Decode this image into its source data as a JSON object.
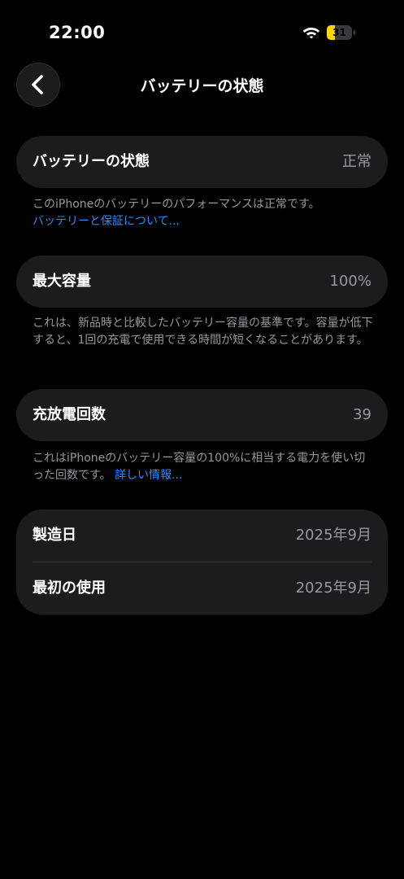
{
  "status_bar": {
    "time": "22:00",
    "battery_level": "31",
    "battery_fraction": 0.31,
    "battery_color": "#ffd60a",
    "icons": [
      "wifi-icon",
      "battery-icon"
    ]
  },
  "nav": {
    "back_icon": "chevron-left-icon",
    "title": "バッテリーの状態"
  },
  "sections": {
    "health": {
      "label": "バッテリーの状態",
      "value": "正常",
      "footnote": "このiPhoneのバッテリーのパフォーマンスは正常です。",
      "link": "バッテリーと保証について..."
    },
    "capacity": {
      "label": "最大容量",
      "value": "100%",
      "footnote": "これは、新品時と比較したバッテリー容量の基準です。容量が低下すると、1回の充電で使用できる時間が短くなることがあります。"
    },
    "cycles": {
      "label": "充放電回数",
      "value": "39",
      "footnote": "これはiPhoneのバッテリー容量の100%に相当する電力を使い切った回数です。",
      "link": "詳しい情報..."
    },
    "dates": {
      "manufacture_label": "製造日",
      "manufacture_value": "2025年9月",
      "first_use_label": "最初の使用",
      "first_use_value": "2025年9月"
    }
  },
  "colors": {
    "background": "#000000",
    "card": "#1c1c1e",
    "secondary_text": "#98989f",
    "link": "#2f8cff"
  }
}
